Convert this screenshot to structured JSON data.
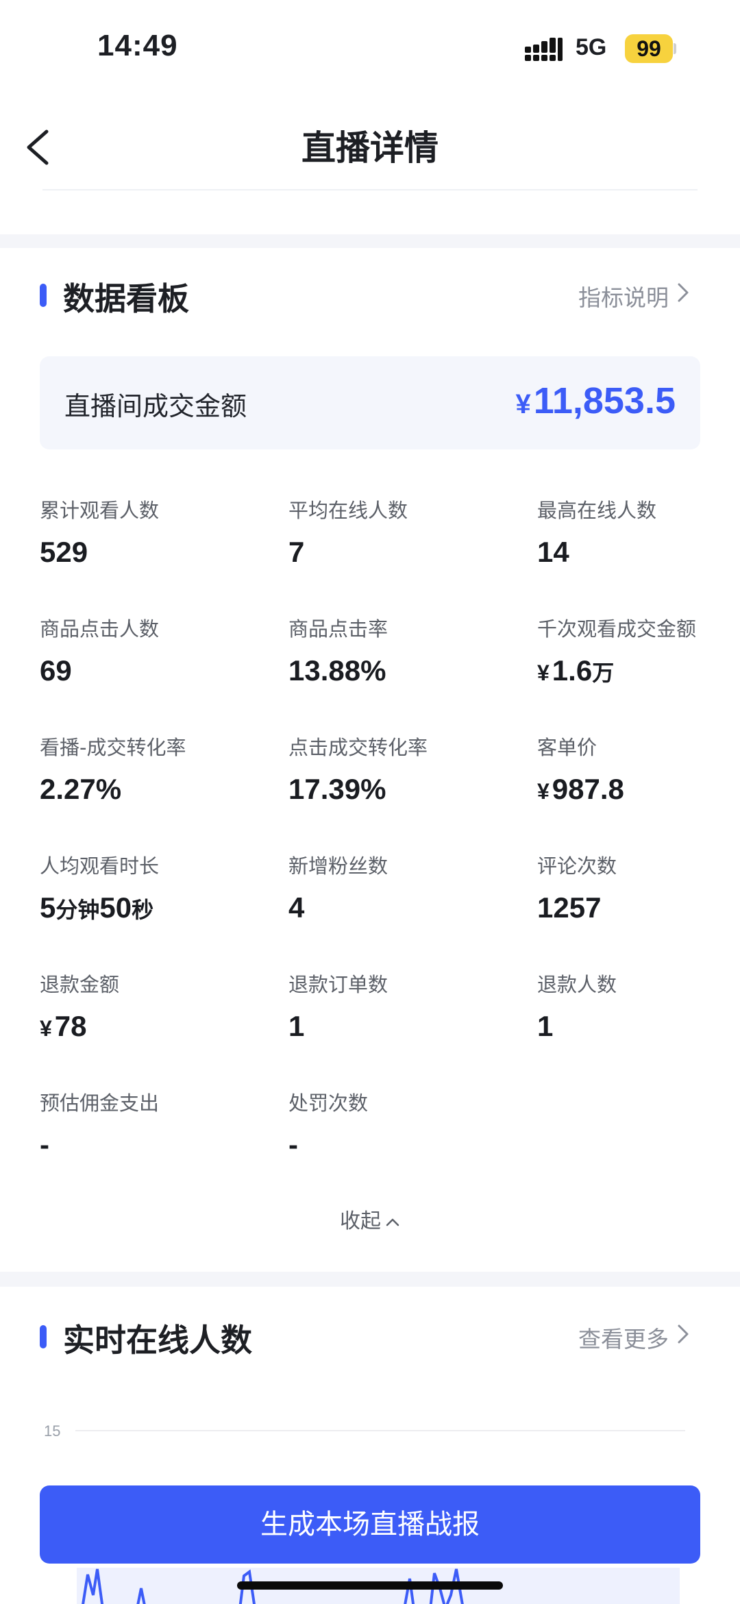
{
  "status_bar": {
    "time": "14:49",
    "network": "5G",
    "battery": "99",
    "battery_color": "#f7d23e"
  },
  "nav": {
    "title": "直播详情",
    "back_icon": "chevron-left-icon"
  },
  "dashboard": {
    "title": "数据看板",
    "link_label": "指标说明",
    "accent_color": "#3c5cf7",
    "gmv": {
      "label": "直播间成交金额",
      "currency": "¥",
      "value": "11,853.5"
    },
    "metrics": [
      {
        "label": "累计观看人数",
        "value": "529"
      },
      {
        "label": "平均在线人数",
        "value": "7"
      },
      {
        "label": "最高在线人数",
        "value": "14"
      },
      {
        "label": "商品点击人数",
        "value": "69"
      },
      {
        "label": "商品点击率",
        "value": "13.88%"
      },
      {
        "label": "千次观看成交金额",
        "currency": "¥",
        "value": "1.6",
        "unit": "万"
      },
      {
        "label": "看播-成交转化率",
        "value": "2.27%"
      },
      {
        "label": "点击成交转化率",
        "value": "17.39%"
      },
      {
        "label": "客单价",
        "currency": "¥",
        "value": "987.8"
      },
      {
        "label": "人均观看时长",
        "value_parts": [
          "5",
          "分钟",
          "50",
          "秒"
        ]
      },
      {
        "label": "新增粉丝数",
        "value": "4"
      },
      {
        "label": "评论次数",
        "value": "1257"
      },
      {
        "label": "退款金额",
        "currency": "¥",
        "value": "78"
      },
      {
        "label": "退款订单数",
        "value": "1"
      },
      {
        "label": "退款人数",
        "value": "1"
      },
      {
        "label": "预估佣金支出",
        "value": "-"
      },
      {
        "label": "处罚次数",
        "value": "-"
      }
    ],
    "collapse_label": "收起"
  },
  "realtime": {
    "title": "实时在线人数",
    "link_label": "查看更多",
    "chart_data": {
      "type": "line",
      "y_ticks": [
        "15"
      ],
      "ylim": [
        0,
        15
      ],
      "grid": true,
      "line_color": "#3c5cf7"
    }
  },
  "cta": {
    "label": "生成本场直播战报"
  }
}
